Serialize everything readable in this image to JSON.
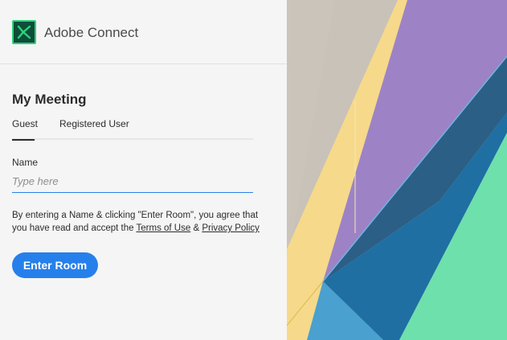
{
  "header": {
    "logo_icon": "adobe-connect-logo-icon",
    "app_title": "Adobe Connect"
  },
  "meeting": {
    "title": "My Meeting"
  },
  "tabs": [
    {
      "label": "Guest",
      "active": true
    },
    {
      "label": "Registered User",
      "active": false
    }
  ],
  "form": {
    "name_label": "Name",
    "name_placeholder": "Type here",
    "name_value": "",
    "consent_prefix": "By entering a Name & clicking \"Enter Room\", you agree that you have read and accept the ",
    "terms_link": "Terms of Use",
    "consent_joiner": " & ",
    "privacy_link": "Privacy Policy",
    "enter_button": "Enter Room"
  },
  "colors": {
    "accent": "#2680eb",
    "panel_bg": "#f5f5f5",
    "logo_green": "#2fd07a"
  }
}
